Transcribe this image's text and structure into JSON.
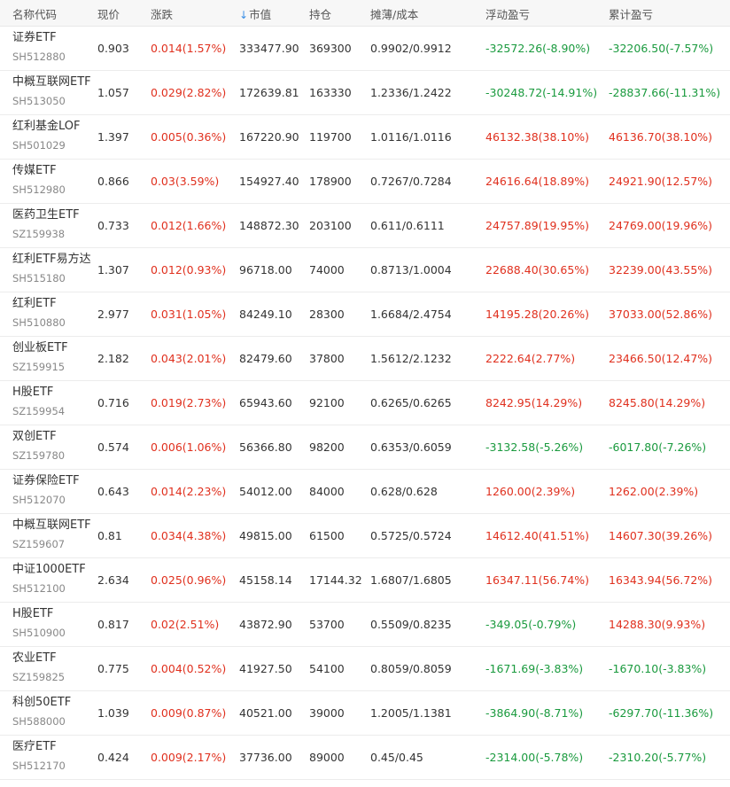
{
  "colors": {
    "up": "#e0301e",
    "down": "#1a9a3e",
    "header_bg": "#f7f7f7",
    "sort_arrow": "#3a8ee6"
  },
  "header": {
    "name": "名称代码",
    "price": "现价",
    "change": "涨跌",
    "sort_icon": "↓",
    "market_value": "市值",
    "position": "持仓",
    "cost": "摊薄/成本",
    "float_pl": "浮动盈亏",
    "total_pl": "累计盈亏"
  },
  "rows": [
    {
      "name": "证券ETF",
      "code": "SH512880",
      "price": "0.903",
      "change": "0.014(1.57%)",
      "market_value": "333477.90",
      "position": "369300",
      "cost": "0.9902/0.9912",
      "float_pl": "-32572.26(-8.90%)",
      "total_pl": "-32206.50(-7.57%)"
    },
    {
      "name": "中概互联网ETF",
      "code": "SH513050",
      "price": "1.057",
      "change": "0.029(2.82%)",
      "market_value": "172639.81",
      "position": "163330",
      "cost": "1.2336/1.2422",
      "float_pl": "-30248.72(-14.91%)",
      "total_pl": "-28837.66(-11.31%)"
    },
    {
      "name": "红利基金LOF",
      "code": "SH501029",
      "price": "1.397",
      "change": "0.005(0.36%)",
      "market_value": "167220.90",
      "position": "119700",
      "cost": "1.0116/1.0116",
      "float_pl": "46132.38(38.10%)",
      "total_pl": "46136.70(38.10%)"
    },
    {
      "name": "传媒ETF",
      "code": "SH512980",
      "price": "0.866",
      "change": "0.03(3.59%)",
      "market_value": "154927.40",
      "position": "178900",
      "cost": "0.7267/0.7284",
      "float_pl": "24616.64(18.89%)",
      "total_pl": "24921.90(12.57%)"
    },
    {
      "name": "医药卫生ETF",
      "code": "SZ159938",
      "price": "0.733",
      "change": "0.012(1.66%)",
      "market_value": "148872.30",
      "position": "203100",
      "cost": "0.611/0.6111",
      "float_pl": "24757.89(19.95%)",
      "total_pl": "24769.00(19.96%)"
    },
    {
      "name": "红利ETF易方达",
      "code": "SH515180",
      "price": "1.307",
      "change": "0.012(0.93%)",
      "market_value": "96718.00",
      "position": "74000",
      "cost": "0.8713/1.0004",
      "float_pl": "22688.40(30.65%)",
      "total_pl": "32239.00(43.55%)"
    },
    {
      "name": "红利ETF",
      "code": "SH510880",
      "price": "2.977",
      "change": "0.031(1.05%)",
      "market_value": "84249.10",
      "position": "28300",
      "cost": "1.6684/2.4754",
      "float_pl": "14195.28(20.26%)",
      "total_pl": "37033.00(52.86%)"
    },
    {
      "name": "创业板ETF",
      "code": "SZ159915",
      "price": "2.182",
      "change": "0.043(2.01%)",
      "market_value": "82479.60",
      "position": "37800",
      "cost": "1.5612/2.1232",
      "float_pl": "2222.64(2.77%)",
      "total_pl": "23466.50(12.47%)"
    },
    {
      "name": "H股ETF",
      "code": "SZ159954",
      "price": "0.716",
      "change": "0.019(2.73%)",
      "market_value": "65943.60",
      "position": "92100",
      "cost": "0.6265/0.6265",
      "float_pl": "8242.95(14.29%)",
      "total_pl": "8245.80(14.29%)"
    },
    {
      "name": "双创ETF",
      "code": "SZ159780",
      "price": "0.574",
      "change": "0.006(1.06%)",
      "market_value": "56366.80",
      "position": "98200",
      "cost": "0.6353/0.6059",
      "float_pl": "-3132.58(-5.26%)",
      "total_pl": "-6017.80(-7.26%)"
    },
    {
      "name": "证券保险ETF",
      "code": "SH512070",
      "price": "0.643",
      "change": "0.014(2.23%)",
      "market_value": "54012.00",
      "position": "84000",
      "cost": "0.628/0.628",
      "float_pl": "1260.00(2.39%)",
      "total_pl": "1262.00(2.39%)"
    },
    {
      "name": "中概互联网ETF",
      "code": "SZ159607",
      "price": "0.81",
      "change": "0.034(4.38%)",
      "market_value": "49815.00",
      "position": "61500",
      "cost": "0.5725/0.5724",
      "float_pl": "14612.40(41.51%)",
      "total_pl": "14607.30(39.26%)"
    },
    {
      "name": "中证1000ETF",
      "code": "SH512100",
      "price": "2.634",
      "change": "0.025(0.96%)",
      "market_value": "45158.14",
      "position": "17144.32",
      "cost": "1.6807/1.6805",
      "float_pl": "16347.11(56.74%)",
      "total_pl": "16343.94(56.72%)"
    },
    {
      "name": "H股ETF",
      "code": "SH510900",
      "price": "0.817",
      "change": "0.02(2.51%)",
      "market_value": "43872.90",
      "position": "53700",
      "cost": "0.5509/0.8235",
      "float_pl": "-349.05(-0.79%)",
      "total_pl": "14288.30(9.93%)"
    },
    {
      "name": "农业ETF",
      "code": "SZ159825",
      "price": "0.775",
      "change": "0.004(0.52%)",
      "market_value": "41927.50",
      "position": "54100",
      "cost": "0.8059/0.8059",
      "float_pl": "-1671.69(-3.83%)",
      "total_pl": "-1670.10(-3.83%)"
    },
    {
      "name": "科创50ETF",
      "code": "SH588000",
      "price": "1.039",
      "change": "0.009(0.87%)",
      "market_value": "40521.00",
      "position": "39000",
      "cost": "1.2005/1.1381",
      "float_pl": "-3864.90(-8.71%)",
      "total_pl": "-6297.70(-11.36%)"
    },
    {
      "name": "医疗ETF",
      "code": "SH512170",
      "price": "0.424",
      "change": "0.009(2.17%)",
      "market_value": "37736.00",
      "position": "89000",
      "cost": "0.45/0.45",
      "float_pl": "-2314.00(-5.78%)",
      "total_pl": "-2310.20(-5.77%)"
    }
  ]
}
